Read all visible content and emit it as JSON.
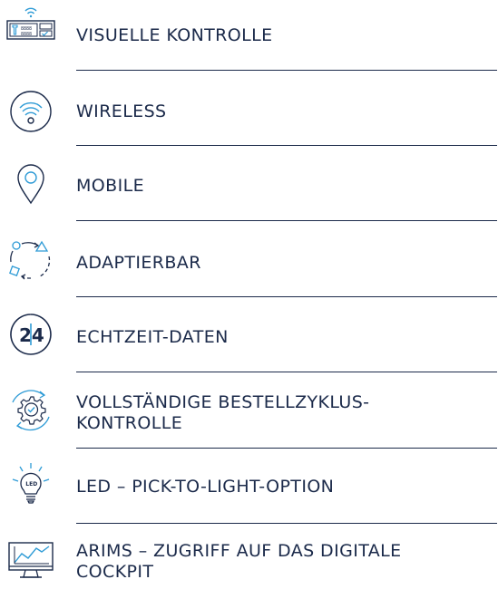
{
  "colors": {
    "text": "#1b2a4a",
    "accent": "#2e9bd6"
  },
  "features": [
    {
      "icon": "visual-control-panel-icon",
      "label": "VISUELLE KONTROLLE",
      "panel_digits": "8888"
    },
    {
      "icon": "wireless-icon",
      "label": "WIRELESS"
    },
    {
      "icon": "location-pin-icon",
      "label": "MOBILE"
    },
    {
      "icon": "adaptive-cycle-icon",
      "label": "ADAPTIERBAR"
    },
    {
      "icon": "realtime-24-icon",
      "label": "ECHTZEIT-DATEN",
      "badge": "24"
    },
    {
      "icon": "gear-check-cycle-icon",
      "label_line1": "VOLLSTÄNDIGE BESTELLZYKLUS-",
      "label_line2": "KONTROLLE"
    },
    {
      "icon": "led-bulb-icon",
      "label": "LED – PICK-TO-LIGHT-OPTION",
      "badge": "LED"
    },
    {
      "icon": "monitor-chart-icon",
      "label_line1": "ARIMS – ZUGRIFF AUF DAS DIGITALE",
      "label_line2": "COCKPIT"
    }
  ]
}
